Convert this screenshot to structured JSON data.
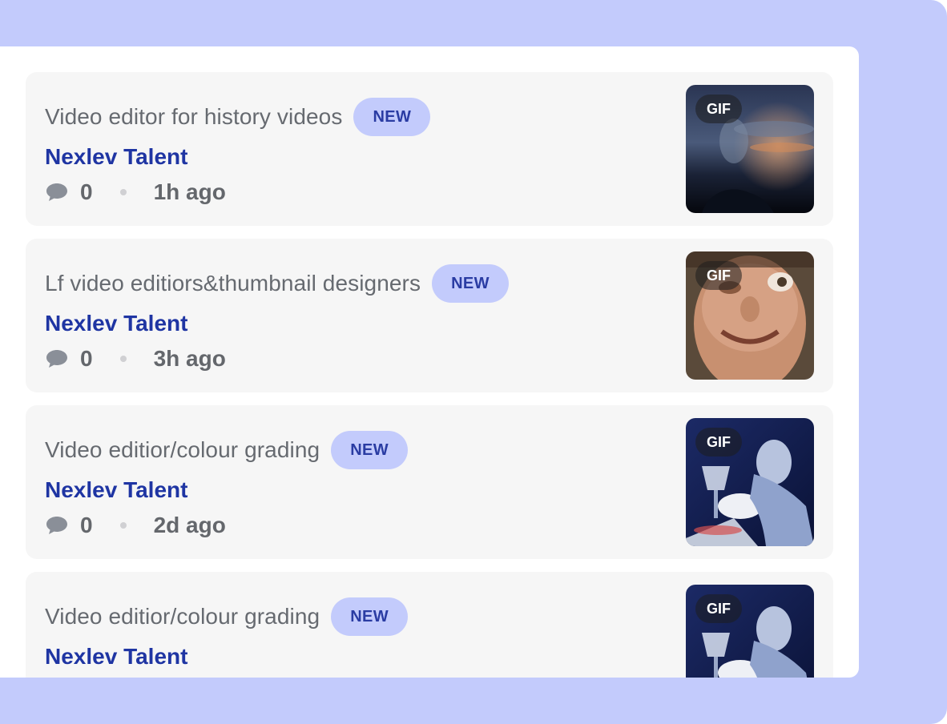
{
  "colors": {
    "frame": "#c3cbfc",
    "badge_bg": "#c3cbfc",
    "badge_text": "#2a3ca3",
    "author": "#1f35a3",
    "card_bg": "#f6f6f6"
  },
  "feed": {
    "posts": [
      {
        "title": "Video editor for history videos",
        "badge": "NEW",
        "author": "Nexlev Talent",
        "comment_icon": "comment-icon",
        "comments": "0",
        "time": "1h ago",
        "thumbnail_label": "GIF"
      },
      {
        "title": "Lf video editiors&thumbnail designers",
        "badge": "NEW",
        "author": "Nexlev Talent",
        "comment_icon": "comment-icon",
        "comments": "0",
        "time": "3h ago",
        "thumbnail_label": "GIF"
      },
      {
        "title": "Video editior/colour grading",
        "badge": "NEW",
        "author": "Nexlev Talent",
        "comment_icon": "comment-icon",
        "comments": "0",
        "time": "2d ago",
        "thumbnail_label": "GIF"
      },
      {
        "title": "Video editior/colour grading",
        "badge": "NEW",
        "author": "Nexlev Talent",
        "comment_icon": "comment-icon",
        "comments": "",
        "time": "",
        "thumbnail_label": "GIF"
      }
    ]
  }
}
